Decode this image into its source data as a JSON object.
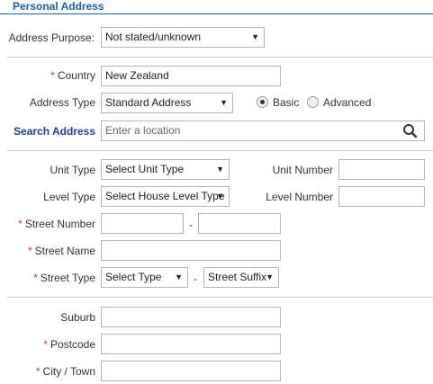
{
  "section": {
    "title": "Personal Address"
  },
  "address_purpose": {
    "label": "Address Purpose:",
    "value": "Not stated/unknown"
  },
  "country": {
    "label": "Country",
    "value": "New Zealand",
    "required_mark": "*"
  },
  "address_type": {
    "label": "Address Type",
    "value": "Standard Address",
    "radio_basic": "Basic",
    "radio_advanced": "Advanced",
    "selected": "Basic"
  },
  "search_address": {
    "label": "Search Address",
    "placeholder": "Enter a location",
    "icon": "search-icon"
  },
  "unit_type": {
    "label": "Unit Type",
    "value": "Select Unit Type"
  },
  "unit_number": {
    "label": "Unit Number",
    "value": ""
  },
  "level_type": {
    "label": "Level Type",
    "value": "Select House Level Type"
  },
  "level_number": {
    "label": "Level Number",
    "value": ""
  },
  "street_number": {
    "label": "Street Number",
    "from": "",
    "to": "",
    "separator": "-",
    "required_mark": "*"
  },
  "street_name": {
    "label": "Street Name",
    "value": "",
    "required_mark": "*"
  },
  "street_type": {
    "label": "Street Type",
    "value": "Select Type",
    "suffix": "Street Suffix",
    "separator": "-",
    "required_mark": "*"
  },
  "suburb": {
    "label": "Suburb",
    "value": ""
  },
  "postcode": {
    "label": "Postcode",
    "value": "",
    "required_mark": "*"
  },
  "city": {
    "label": "City / Town",
    "value": "",
    "required_mark": "*"
  },
  "colors": {
    "accent": "#1f5f9c",
    "required": "#d03030",
    "border": "#b5b5b5"
  }
}
